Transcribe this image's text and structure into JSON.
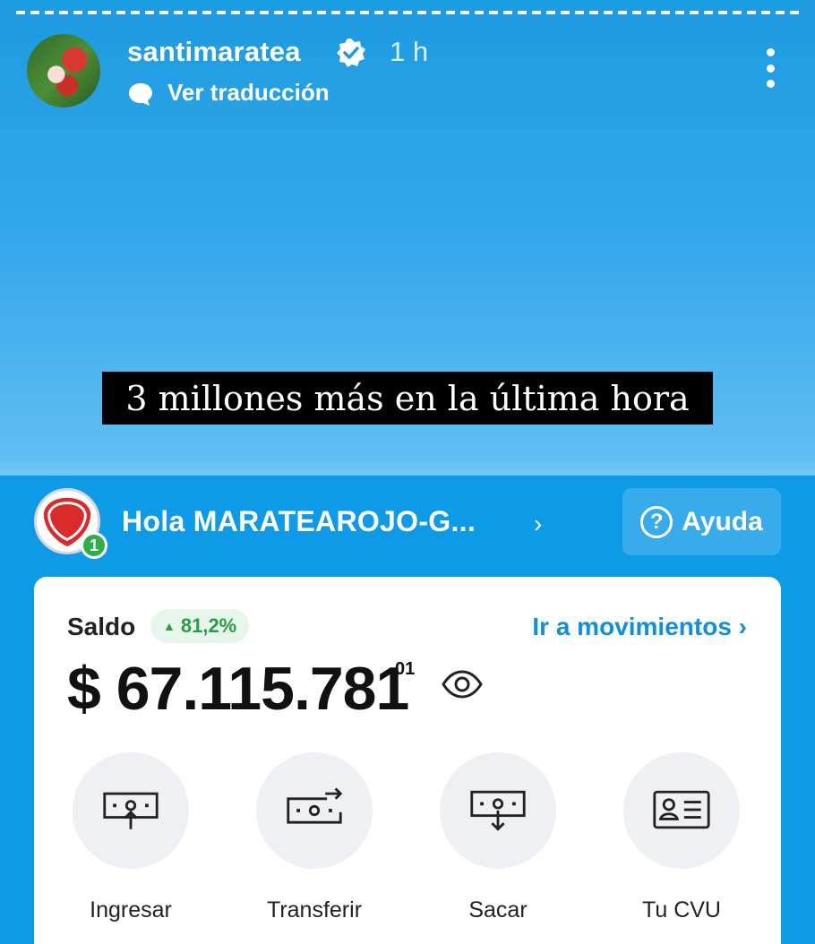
{
  "story": {
    "username": "santimaratea",
    "time": "1 h",
    "translate_label": "Ver traducción",
    "caption": "3 millones más en la última hora"
  },
  "app": {
    "greeting": "Hola MARATEAROJO-G...",
    "badge_count": "1",
    "help_label": "Ayuda",
    "help_icon_text": "?",
    "balance": {
      "label": "Saldo",
      "variation": "81,2%",
      "movements_link": "Ir a movimientos",
      "amount": "$ 67.115.781",
      "cents": "01"
    },
    "actions": [
      {
        "label": "Ingresar",
        "icon": "deposit-icon"
      },
      {
        "label": "Transferir",
        "icon": "transfer-icon"
      },
      {
        "label": "Sacar",
        "icon": "withdraw-icon"
      },
      {
        "label": "Tu CVU",
        "icon": "id-card-icon"
      }
    ]
  },
  "colors": {
    "story_bg_top": "#1c9be0",
    "app_bg": "#0d9ae6",
    "accent_link": "#0e8fdf",
    "positive": "#2a9c45",
    "badge_green": "#2fae4b"
  }
}
